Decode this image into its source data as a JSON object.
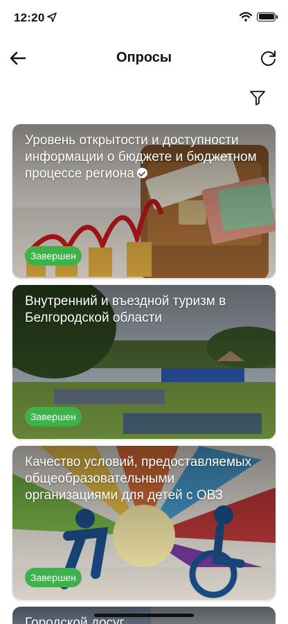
{
  "status_bar": {
    "time": "12:20"
  },
  "nav": {
    "title": "Опросы"
  },
  "surveys": [
    {
      "title": "Уровень открытости и доступности информации о бюджете и бюджетном процессе региона",
      "status": "Завершен",
      "verified": true
    },
    {
      "title": "Внутренний и въездной туризм в Белгородской области",
      "status": "Завершен",
      "verified": false
    },
    {
      "title": "Качество условий, предоставляемых общеобразовательными организациями для детей с ОВЗ",
      "status": "Завершен",
      "verified": false
    },
    {
      "title": "Городской досуг"
    }
  ],
  "colors": {
    "status_green": "#3db24b"
  }
}
